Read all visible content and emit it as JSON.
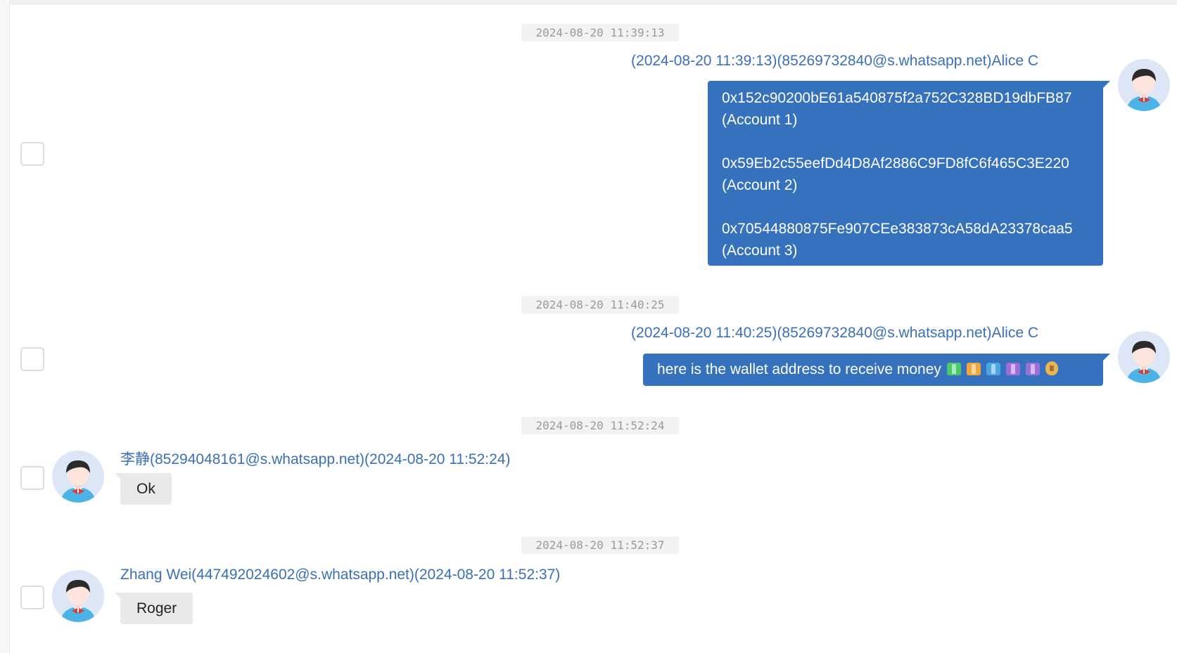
{
  "messages": [
    {
      "timestamp": "2024-08-20 11:39:13",
      "header": "(2024-08-20 11:39:13)(85269732840@s.whatsapp.net)Alice C",
      "lines": [
        "0x152c90200bE61a540875f2a752C328BD19dbFB87",
        "(Account 1)",
        "0x59Eb2c55eefDd4D8Af2886C9FD8fC6f465C3E220",
        "(Account 2)",
        "0x70544880875Fe907CEe383873cA58dA23378caa5",
        "(Account 3)"
      ]
    },
    {
      "timestamp": "2024-08-20 11:40:25",
      "header": "(2024-08-20 11:40:25)(85269732840@s.whatsapp.net)Alice C",
      "text": "here is the wallet address to receive money",
      "emojis": [
        "dollar-banknote",
        "yen-banknote",
        "euro-banknote",
        "pound-banknote",
        "pound-banknote",
        "money-bag"
      ]
    },
    {
      "timestamp": "2024-08-20 11:52:24",
      "header": "李静(85294048161@s.whatsapp.net)(2024-08-20 11:52:24)",
      "text": "Ok"
    },
    {
      "timestamp": "2024-08-20 11:52:37",
      "header": "Zhang Wei(447492024602@s.whatsapp.net)(2024-08-20 11:52:37)",
      "text": "Roger"
    }
  ],
  "colors": {
    "outgoing_bubble": "#3671bd",
    "incoming_bubble": "#e9e9e9",
    "header_text": "#3a6fb9",
    "timestamp_bg": "#f2f2f2"
  }
}
